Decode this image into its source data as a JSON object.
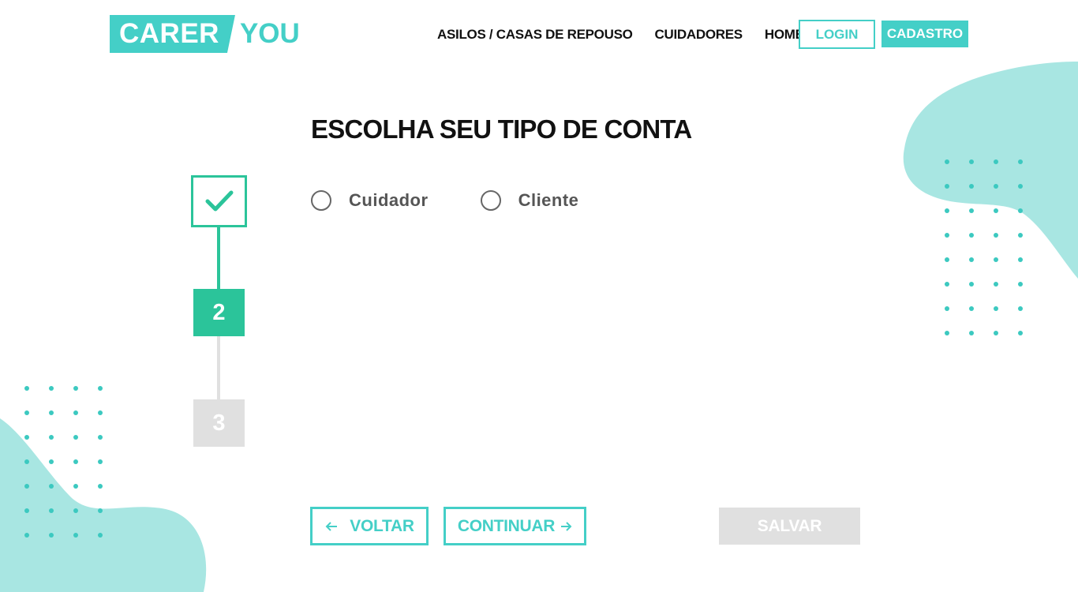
{
  "brand": {
    "logo_left": "CARER",
    "logo_right": "YOU",
    "accent_color": "#44cfc7",
    "step_color": "#2bc49a",
    "disabled_color": "#e0e0e0"
  },
  "nav": {
    "items": [
      {
        "label": "ASILOS / CASAS DE REPOUSO"
      },
      {
        "label": "CUIDADORES"
      },
      {
        "label": "HOME"
      }
    ],
    "login_label": "LOGIN",
    "signup_label": "CADASTRO"
  },
  "main": {
    "title": "ESCOLHA SEU TIPO DE CONTA",
    "steps": [
      {
        "label": "",
        "state": "completed",
        "icon": "check-icon"
      },
      {
        "label": "2",
        "state": "active"
      },
      {
        "label": "3",
        "state": "inactive"
      }
    ],
    "account_options": [
      {
        "label": "Cuidador",
        "selected": false
      },
      {
        "label": "Cliente",
        "selected": false
      }
    ],
    "buttons": {
      "back_label": "VOLTAR",
      "back_icon": "arrow-left-icon",
      "continue_label": "CONTINUAR",
      "continue_icon": "arrow-right-icon",
      "save_label": "SALVAR"
    }
  }
}
